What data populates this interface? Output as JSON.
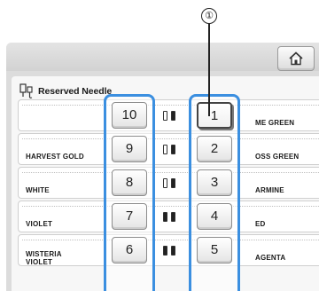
{
  "callout": {
    "number": "①"
  },
  "header": {
    "home_icon": "home-icon"
  },
  "panel": {
    "title": "Reserved Needle",
    "title_icon": "needle-icon"
  },
  "rows": [
    {
      "left_color": "",
      "left_spool": "white",
      "right_spool": "dark",
      "right_color": "ME GREEN"
    },
    {
      "left_color": "HARVEST GOLD",
      "left_spool": "white",
      "right_spool": "dark",
      "right_color": "OSS GREEN"
    },
    {
      "left_color": "WHITE",
      "left_spool": "white",
      "right_spool": "dark",
      "right_color": "ARMINE"
    },
    {
      "left_color": "VIOLET",
      "left_spool": "dark",
      "right_spool": "dark",
      "right_color": "ED"
    },
    {
      "left_color": "WISTERIA\nVIOLET",
      "left_spool": "dark",
      "right_spool": "dark",
      "right_color": "AGENTA"
    }
  ],
  "needles_left": [
    "10",
    "9",
    "8",
    "7",
    "6"
  ],
  "needles_right": [
    "1",
    "2",
    "3",
    "4",
    "5"
  ],
  "selected_needle": "1",
  "colors": {
    "highlight_border": "#3b8fe0",
    "spool_dark": "#222222",
    "spool_white": "#ffffff"
  }
}
